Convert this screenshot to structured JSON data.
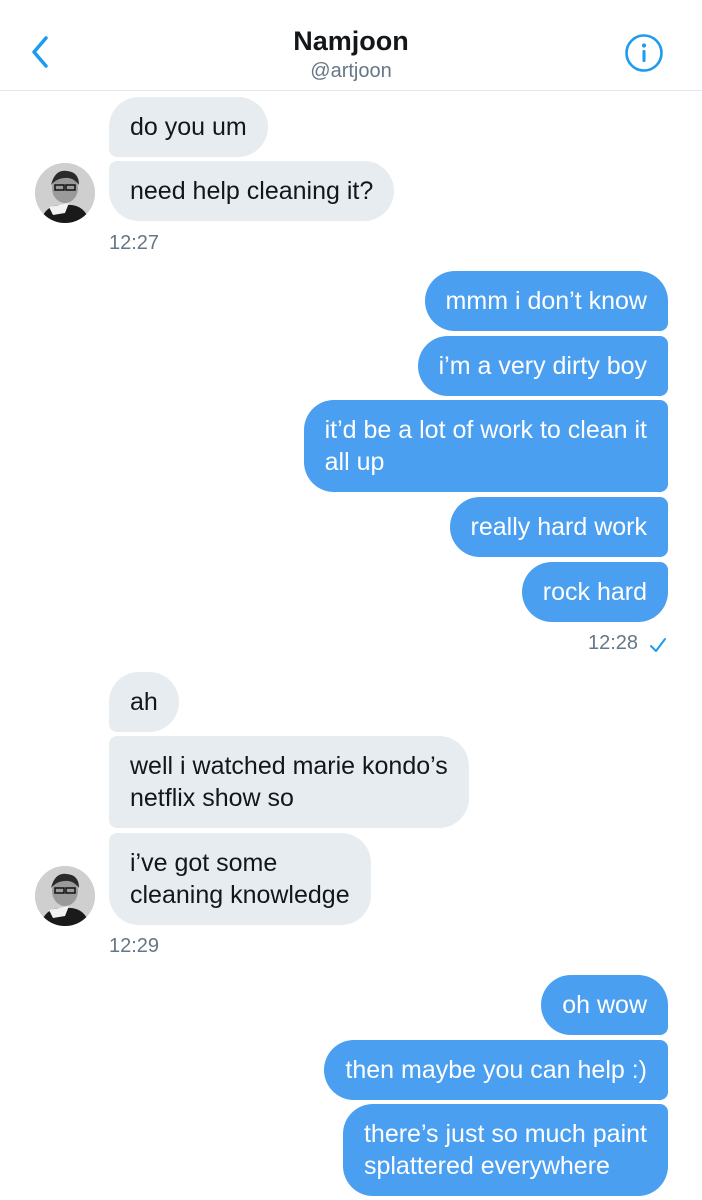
{
  "header": {
    "name": "Namjoon",
    "handle": "@artjoon"
  },
  "icons": {
    "back": "chevron-left-icon",
    "info": "info-circle-icon",
    "read": "checkmark-icon"
  },
  "colors": {
    "accent": "#1d9bf0",
    "outgoing_bubble": "#4a9ff0",
    "incoming_bubble": "#e6ecf0"
  },
  "messages": {
    "g1": [
      "do you um",
      "need help cleaning it?"
    ],
    "t1": "12:27",
    "g2": [
      "mmm i don’t know",
      "i’m a very dirty boy",
      "it’d be a lot of work to clean it\nall up",
      "really hard work",
      "rock hard"
    ],
    "t2": "12:28",
    "g3": [
      "ah",
      "well i watched marie kondo’s\nnetflix show so",
      "i’ve got some\ncleaning knowledge"
    ],
    "t3": "12:29",
    "g4": [
      "oh wow",
      "then maybe you can help :)",
      "there’s just so much paint\nsplattered everywhere"
    ]
  }
}
